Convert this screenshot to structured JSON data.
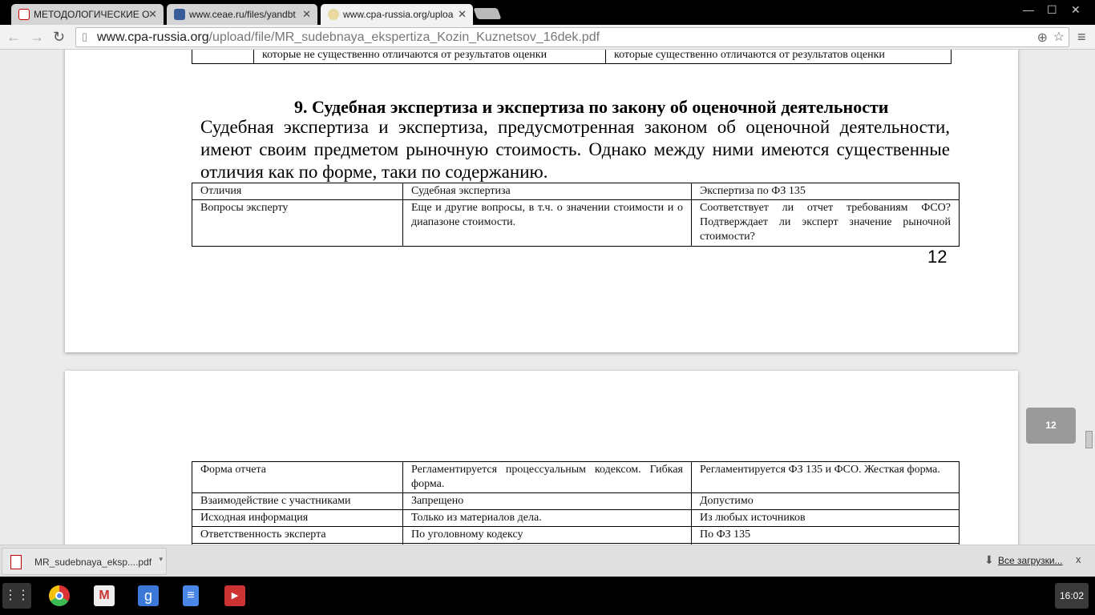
{
  "tabs": [
    {
      "label": "МЕТОДОЛОГИЧЕСКИЕ О"
    },
    {
      "label": "www.ceae.ru/files/yandbt"
    },
    {
      "label": "www.cpa-russia.org/uploa"
    }
  ],
  "address": {
    "host": "www.cpa-russia.org",
    "path": "/upload/file/MR_sudebnaya_ekspertiza_Kozin_Kuznetsov_16dek.pdf"
  },
  "page1": {
    "top_row": [
      "",
      "которые не существенно отличаются от результатов оценки",
      "которые существенно отличаются от результатов оценки"
    ],
    "heading": "9.   Судебная экспертиза и экспертиза по закону об оценочной деятельности",
    "paragraph": "Судебная экспертиза и экспертиза, предусмотренная законом об оценочной деятельности, имеют своим предметом рыночную стоимость. Однако между ними имеются существенные отличия как по форме, таки по содержанию.",
    "table": [
      [
        "Отличия",
        "Судебная экспертиза",
        "Экспертиза по ФЗ 135"
      ],
      [
        "Вопросы эксперту",
        "Еще и другие вопросы, в т.ч. о значении стоимости и о диапазоне стоимости.",
        "Соответствует ли отчет требованиям ФСО? Подтверждает ли эксперт значение рыночной стоимости?"
      ]
    ],
    "page_number": "12"
  },
  "page2": {
    "table": [
      [
        "Форма отчета",
        "Регламентируется процессуальным кодексом. Гибкая форма.",
        "Регламентируется ФЗ 135 и ФСО. Жесткая форма."
      ],
      [
        "Взаимодействие с участниками",
        "Запрещено",
        "Допустимо"
      ],
      [
        "Исходная информация",
        "Только из материалов дела.",
        "Из любых источников"
      ],
      [
        "Ответственность эксперта",
        "По уголовному кодексу",
        "По ФЗ 135"
      ]
    ]
  },
  "page_indicator": "12",
  "download": {
    "file": "MR_sudebnaya_eksp....pdf",
    "all_downloads": "Все загрузки...",
    "close": "x"
  },
  "clock": "16:02"
}
